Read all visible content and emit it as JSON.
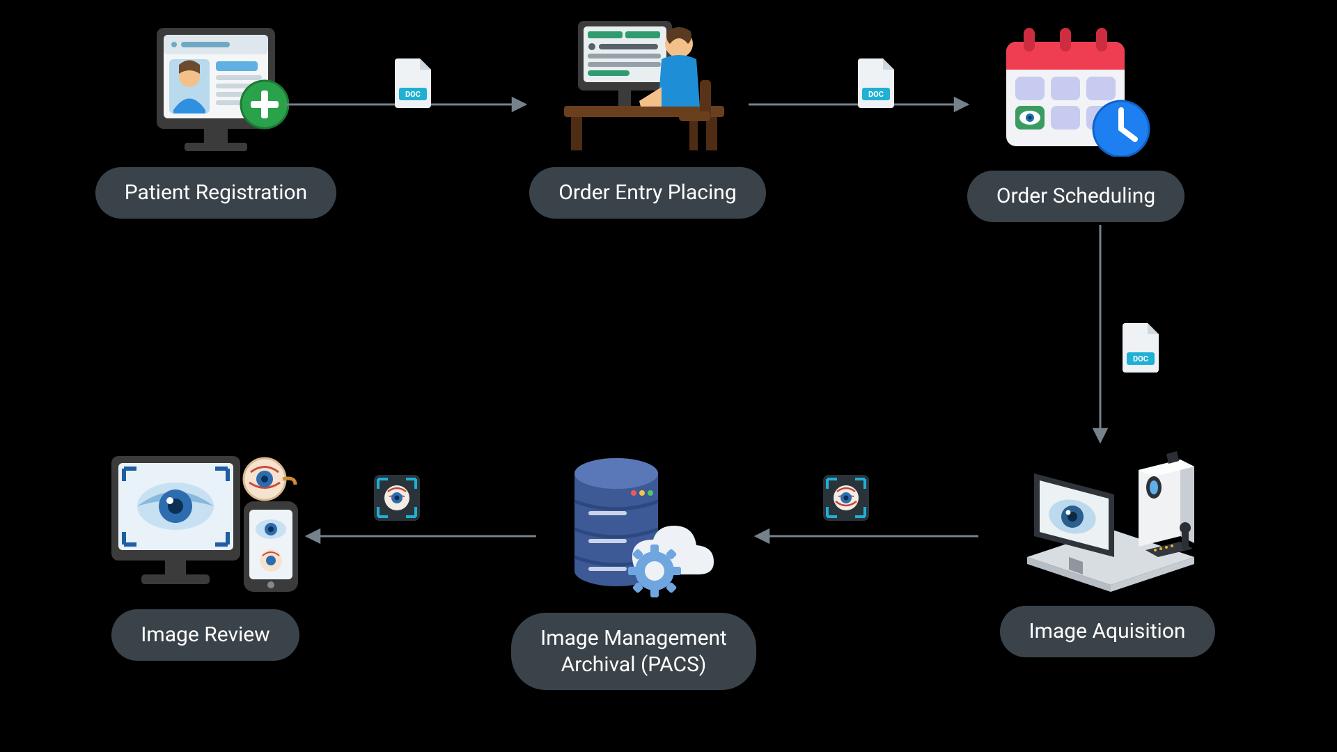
{
  "nodes": {
    "patient_registration": {
      "label": "Patient Registration"
    },
    "order_entry": {
      "label": "Order Entry Placing"
    },
    "order_scheduling": {
      "label": "Order Scheduling"
    },
    "image_acquisition": {
      "label": "Image Aquisition"
    },
    "image_management": {
      "label": "Image Management\nArchival (PACS)"
    },
    "image_review": {
      "label": "Image Review"
    }
  },
  "badge_text": {
    "doc": "DOC"
  }
}
